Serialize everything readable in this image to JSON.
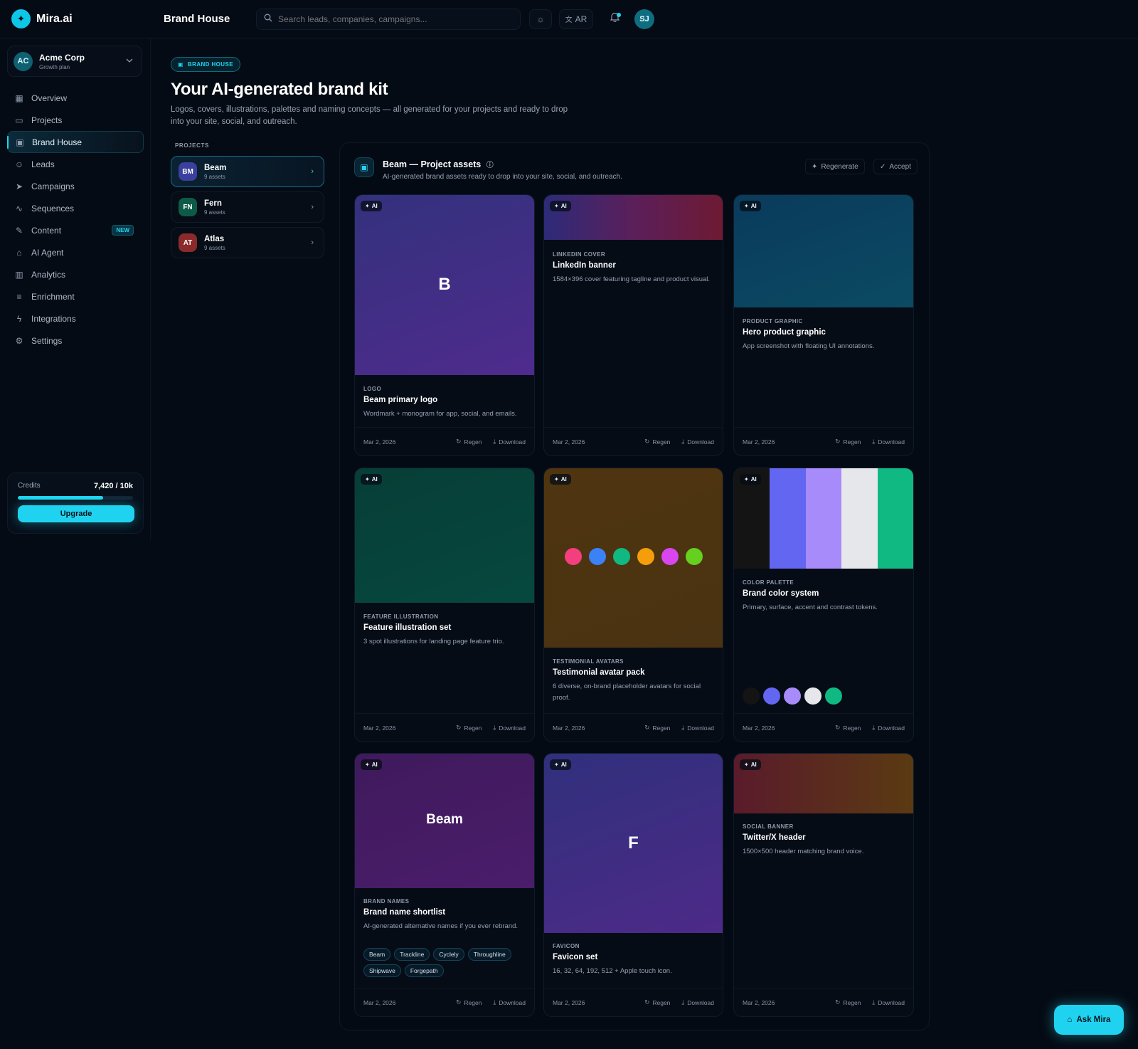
{
  "app": {
    "name": "Mira.ai",
    "page_title": "Brand House"
  },
  "topbar": {
    "search_placeholder": "Search leads, companies, campaigns...",
    "lang": "AR",
    "avatar": "SJ"
  },
  "org": {
    "initials": "AC",
    "name": "Acme Corp",
    "plan": "Growth plan"
  },
  "nav": [
    {
      "label": "Overview",
      "icon": "grid-icon"
    },
    {
      "label": "Projects",
      "icon": "folder-icon"
    },
    {
      "label": "Brand House",
      "icon": "image-icon",
      "active": true
    },
    {
      "label": "Leads",
      "icon": "users-icon"
    },
    {
      "label": "Campaigns",
      "icon": "send-icon"
    },
    {
      "label": "Sequences",
      "icon": "route-icon"
    },
    {
      "label": "Content",
      "icon": "wand-icon",
      "badge": "NEW"
    },
    {
      "label": "AI Agent",
      "icon": "bot-icon"
    },
    {
      "label": "Analytics",
      "icon": "bar-chart-icon"
    },
    {
      "label": "Enrichment",
      "icon": "database-icon"
    },
    {
      "label": "Integrations",
      "icon": "plug-icon"
    },
    {
      "label": "Settings",
      "icon": "gear-icon"
    }
  ],
  "credits": {
    "label": "Credits",
    "value": "7,420 / 10k",
    "fraction": 0.742,
    "button": "Upgrade"
  },
  "hero": {
    "pill": "BRAND HOUSE",
    "title": "Your AI-generated brand kit",
    "subtitle": "Logos, covers, illustrations, palettes and naming concepts — all generated for your projects and ready to drop into your site, social, and outreach."
  },
  "projects": {
    "label": "PROJECTS",
    "items": [
      {
        "initials": "BM",
        "name": "Beam",
        "count": "9 assets",
        "color": "#3b3f9e",
        "active": true
      },
      {
        "initials": "FN",
        "name": "Fern",
        "count": "9 assets",
        "color": "#0e5a48"
      },
      {
        "initials": "AT",
        "name": "Atlas",
        "count": "9 assets",
        "color": "#8a2a2a"
      }
    ]
  },
  "panel": {
    "title": "Beam — Project assets",
    "subtitle": "AI-generated brand assets ready to drop into your site, social, and outreach.",
    "regenerate": "Regenerate",
    "accept": "Accept"
  },
  "card_common": {
    "ai": "AI",
    "date": "Mar 2, 2026",
    "regen": "Regen",
    "download": "Download"
  },
  "cards": [
    {
      "type": "LOGO",
      "title": "Beam primary logo",
      "desc": "Wordmark + monogram for app, social, and emails.",
      "monogram": "B"
    },
    {
      "type": "LINKEDIN COVER",
      "title": "LinkedIn banner",
      "desc": "1584×396 cover featuring tagline and product visual."
    },
    {
      "type": "PRODUCT GRAPHIC",
      "title": "Hero product graphic",
      "desc": "App screenshot with floating UI annotations."
    },
    {
      "type": "FEATURE ILLUSTRATION",
      "title": "Feature illustration set",
      "desc": "3 spot illustrations for landing page feature trio."
    },
    {
      "type": "TESTIMONIAL AVATARS",
      "title": "Testimonial avatar pack",
      "desc": "6 diverse, on-brand placeholder avatars for social proof.",
      "avatar_colors": [
        "#f43f7e",
        "#3b82f6",
        "#10b981",
        "#f59e0b",
        "#d946ef",
        "#65d01f"
      ]
    },
    {
      "type": "COLOR PALETTE",
      "title": "Brand color system",
      "desc": "Primary, surface, accent and contrast tokens.",
      "palette": [
        "#141414",
        "#6366f1",
        "#a78bfa",
        "#e5e7eb",
        "#10b981"
      ]
    },
    {
      "type": "BRAND NAMES",
      "title": "Brand name shortlist",
      "desc": "AI-generated alternative names if you ever rebrand.",
      "wordmark": "Beam",
      "names": [
        "Beam",
        "Trackline",
        "Cyclely",
        "Throughline",
        "Shipwave",
        "Forgepath"
      ]
    },
    {
      "type": "FAVICON",
      "title": "Favicon set",
      "desc": "16, 32, 64, 192, 512 + Apple touch icon.",
      "monogram": "F"
    },
    {
      "type": "SOCIAL BANNER",
      "title": "Twitter/X header",
      "desc": "1500×500 header matching brand voice."
    }
  ],
  "ask": {
    "label": "Ask Mira"
  }
}
